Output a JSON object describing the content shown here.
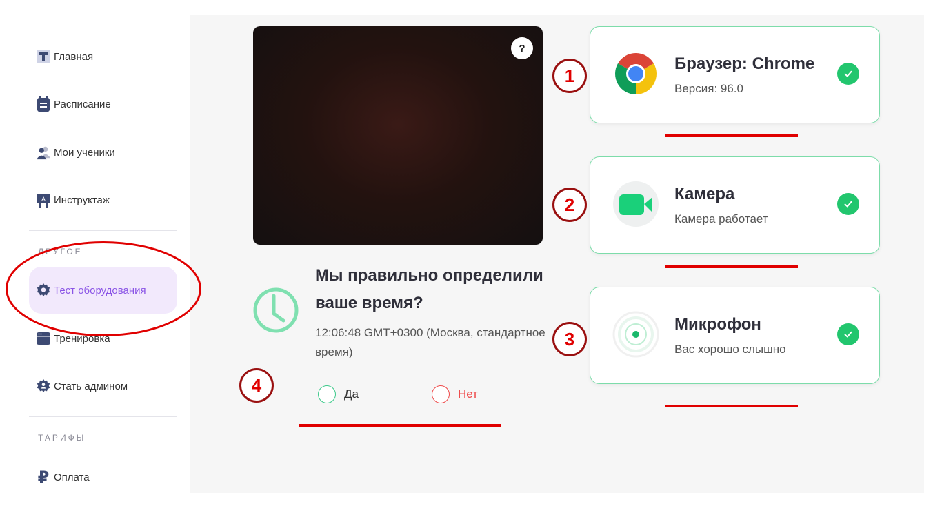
{
  "sidebar": {
    "items": [
      {
        "label": "Главная",
        "icon": "home-icon"
      },
      {
        "label": "Расписание",
        "icon": "calendar-icon"
      },
      {
        "label": "Мои ученики",
        "icon": "students-icon"
      },
      {
        "label": "Инструктаж",
        "icon": "presentation-icon"
      },
      {
        "label": "Тест оборудования",
        "icon": "gear-icon",
        "active": true
      },
      {
        "label": "Тренировка",
        "icon": "browser-window-icon"
      },
      {
        "label": "Стать админом",
        "icon": "admin-badge-icon"
      },
      {
        "label": "Оплата",
        "icon": "ruble-icon"
      }
    ],
    "section_other": "ДРУГОЕ",
    "section_tariffs": "ТАРИФЫ"
  },
  "video": {
    "help_label": "?"
  },
  "timezone": {
    "question": "Мы правильно определили ваше время?",
    "time": "12:06:48 GMT+0300 (Москва, стандартное время)",
    "yes_label": "Да",
    "no_label": "Нет"
  },
  "cards": [
    {
      "title": "Браузер: Chrome",
      "subtitle": "Версия: 96.0",
      "icon": "chrome-icon",
      "status": "ok"
    },
    {
      "title": "Камера",
      "subtitle": "Камера работает",
      "icon": "camera-icon",
      "status": "ok"
    },
    {
      "title": "Микрофон",
      "subtitle": "Вас хорошо слышно",
      "icon": "microphone-signal-icon",
      "status": "ok"
    }
  ],
  "annotations": [
    "1",
    "2",
    "3",
    "4"
  ],
  "colors": {
    "accent_green": "#22c66e",
    "card_border": "#7ddcaa",
    "active_purple": "#8b55e6",
    "active_bg": "#f2e9fc",
    "danger_red": "#ef4b4b",
    "annotation_red": "#e00000"
  }
}
